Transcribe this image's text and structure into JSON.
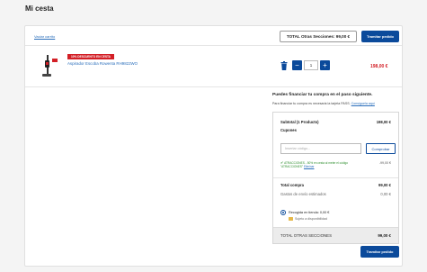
{
  "page_title": "Mi cesta",
  "topbar": {
    "clear_cart": "Vaciar carrito",
    "total_label": "TOTAL Otras Secciones: 99,00 €",
    "checkout_button": "Tramitar pedido"
  },
  "product": {
    "badge": "10% DESCUENTO EN CESTA",
    "name": "Aspirador Escoba Rowenta RH9822WO",
    "quantity": "1",
    "price": "198,00 €",
    "image_icon": "vacuum-cleaner-icon",
    "delete_icon": "trash-icon",
    "minus_label": "−",
    "plus_label": "+"
  },
  "finance": {
    "title": "Puedes financiar tu compra en el paso siguiente.",
    "subtitle": "Para financiar tu compra es necesaria la tarjeta PASS.",
    "link": "Consíguela aquí"
  },
  "summary": {
    "subtotal_label": "Subtotal (1 Producto)",
    "subtotal_value": "198,00 €",
    "coupons_label": "Cupones",
    "coupon_placeholder": "Insertar código...",
    "check_button": "Comprobar",
    "coupon_text": "ATRACCIONES - 50% en cesta al meter el código \"ATRACCIONES\"",
    "coupon_remove": "Eliminar",
    "coupon_amount": "-99,00 €",
    "total_label": "Total compra",
    "total_value": "99,00 €",
    "shipping_label": "Gastos de envío estimados",
    "shipping_value": "0,00 €",
    "pickup_label": "Recogida en tienda: 0,00 €",
    "availability_label": "Sujeto a disponibilidad",
    "other_sections_label": "TOTAL OTRAS SECCIONES",
    "other_sections_value": "99,00 €"
  },
  "bottom": {
    "checkout_button": "Tramitar pedido"
  },
  "colors": {
    "primary": "#0b4a9b",
    "discount_red": "#d31f26",
    "link_blue": "#2a6ebb",
    "coupon_green": "#2f8f2f"
  }
}
